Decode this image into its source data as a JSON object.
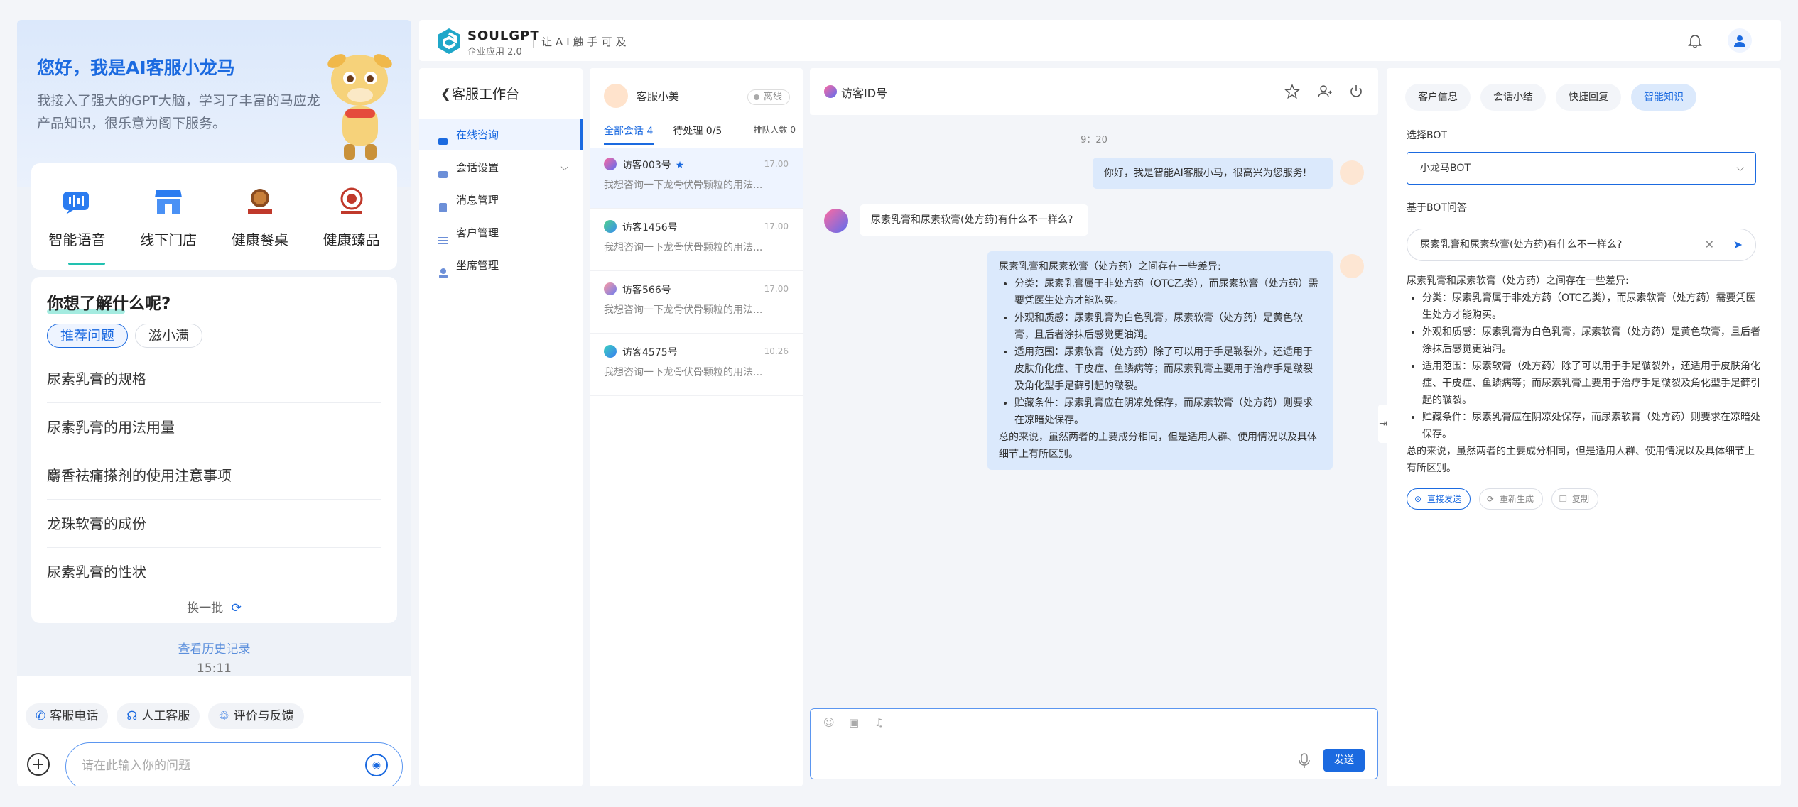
{
  "mobile": {
    "hero_title": "您好，我是AI客服小龙马",
    "hero_desc": "我接入了强大的GPT大脑，学习了丰富的马应龙产品知识，很乐意为阁下服务。",
    "categories": [
      {
        "label": "智能语音",
        "icon": "voice-wave-icon"
      },
      {
        "label": "线下门店",
        "icon": "store-icon"
      },
      {
        "label": "健康餐桌",
        "icon": "brand-badge-icon"
      },
      {
        "label": "健康臻品",
        "icon": "brand-seal-icon"
      }
    ],
    "questions_title": "你想了解什么呢?",
    "question_tabs": [
      "推荐问题",
      "滋小满"
    ],
    "questions": [
      "尿素乳膏的规格",
      "尿素乳膏的用法用量",
      "麝香祛痛搽剂的使用注意事项",
      "龙珠软膏的成份",
      "尿素乳膏的性状"
    ],
    "refresh_label": "换一批",
    "history_link": "查看历史记录",
    "time": "15:11",
    "quick_actions": [
      "客服电话",
      "人工客服",
      "评价与反馈"
    ],
    "input_placeholder": "请在此输入你的问题"
  },
  "topbar": {
    "brand": "SOULGPT",
    "brand_sub": "企业应用 2.0",
    "slogan": "让AI触手可及"
  },
  "nav": {
    "title": "客服工作台",
    "items": [
      "在线咨询",
      "会话设置",
      "消息管理",
      "客户管理",
      "坐席管理"
    ]
  },
  "sessions": {
    "agent_name": "客服小美",
    "status": "离线",
    "tabs": [
      "全部会话 4",
      "待处理 0/5",
      "排队人数 0"
    ],
    "items": [
      {
        "name": "访客003号",
        "time": "17.00",
        "msg": "我想咨询一下龙骨伏骨颗粒的用法..."
      },
      {
        "name": "访客1456号",
        "time": "17.00",
        "msg": "我想咨询一下龙骨伏骨颗粒的用法..."
      },
      {
        "name": "访客566号",
        "time": "17.00",
        "msg": "我想咨询一下龙骨伏骨颗粒的用法..."
      },
      {
        "name": "访客4575号",
        "time": "10.26",
        "msg": "我想咨询一下龙骨伏骨颗粒的用法..."
      }
    ]
  },
  "chat": {
    "visitor_title": "访客ID号",
    "timestamp": "9：20",
    "greeting": "你好，我是智能AI客服小马，很高兴为您服务!",
    "question": "尿素乳膏和尿素软膏(处方药)有什么不一样么?",
    "answer_intro": "尿素乳膏和尿素软膏（处方药）之间存在一些差异:",
    "answer_points": [
      "分类：尿素乳膏属于非处方药（OTC乙类），而尿素软膏（处方药）需要凭医生处方才能购买。",
      "外观和质感：尿素乳膏为白色乳膏，尿素软膏（处方药）是黄色软膏，且后者涂抹后感觉更油润。",
      "适用范围：尿素软膏（处方药）除了可以用于手足皲裂外，还适用于皮肤角化症、干皮症、鱼鳞病等；而尿素乳膏主要用于治疗手足皲裂及角化型手足藓引起的皲裂。",
      "贮藏条件：尿素乳膏应在阴凉处保存，而尿素软膏（处方药）则要求在凉暗处保存。"
    ],
    "answer_outro": "总的来说，虽然两者的主要成分相同，但是适用人群、使用情况以及具体细节上有所区别。",
    "send_label": "发送"
  },
  "rpanel": {
    "tabs": [
      "客户信息",
      "会话小结",
      "快捷回复",
      "智能知识"
    ],
    "select_label": "选择BOT",
    "select_value": "小龙马BOT",
    "ask_label": "基于BOT问答",
    "ask_value": "尿素乳膏和尿素软膏(处方药)有什么不一样么?",
    "actions": [
      "直接发送",
      "重新生成",
      "复制"
    ]
  },
  "colors": {
    "accent": "#1b6ae0",
    "bubble_out": "#dbe9fc",
    "page_bg": "#f3f5f9"
  }
}
